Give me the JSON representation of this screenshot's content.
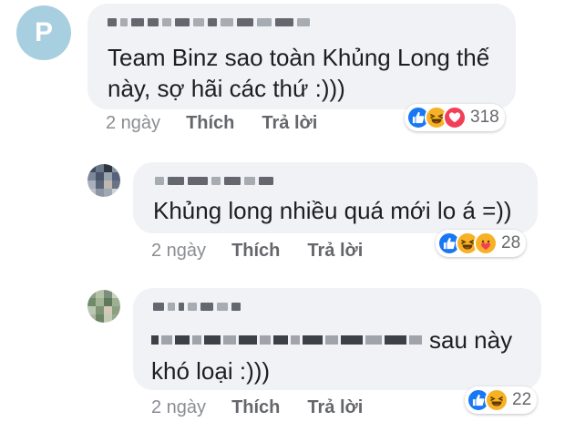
{
  "comments": [
    {
      "avatar_letter": "P",
      "text_lines": [
        "Team Binz sao toàn Khủng Long thế",
        "này, sợ hãi các thứ :)))"
      ],
      "time": "2 ngày",
      "like_label": "Thích",
      "reply_label": "Trả lời",
      "reaction_count": "318",
      "reactions": [
        "like-icon",
        "haha-icon",
        "love-icon"
      ]
    },
    {
      "text_lines": [
        "Khủng long nhiều quá mới lo á =))"
      ],
      "time": "2 ngày",
      "like_label": "Thích",
      "reply_label": "Trả lời",
      "reaction_count": "28",
      "reactions": [
        "like-icon",
        "haha-icon",
        "care-icon"
      ]
    },
    {
      "text_line1_tail": "sau này",
      "text_line2": "khó loại :)))",
      "time": "2 ngày",
      "like_label": "Thích",
      "reply_label": "Trả lời",
      "reaction_count": "22",
      "reactions": [
        "like-icon",
        "haha-icon"
      ]
    }
  ],
  "colors": {
    "bubble": "#f0f2f5",
    "like": "#1877f2",
    "haha": "#f7b125",
    "love": "#f33e58",
    "meta": "#65676b"
  }
}
